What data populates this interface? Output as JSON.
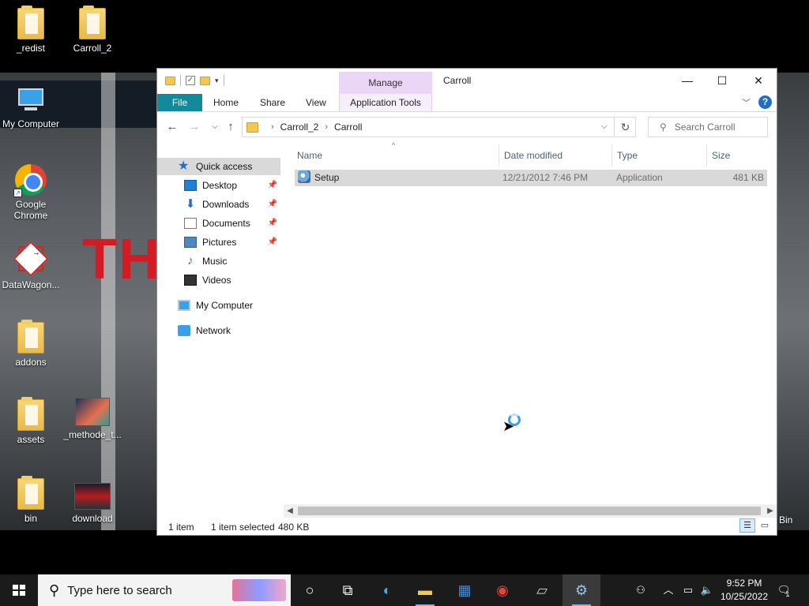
{
  "desktop": {
    "icons": [
      {
        "label": "_redist",
        "icon": "folder-icon"
      },
      {
        "label": "Carroll_2",
        "icon": "folder-icon"
      },
      {
        "label": "My Computer",
        "icon": "computer-icon"
      },
      {
        "label": "Google Chrome",
        "icon": "chrome-icon"
      },
      {
        "label": "DataWagon...",
        "icon": "datawagon-icon"
      },
      {
        "label": "addons",
        "icon": "folder-icon"
      },
      {
        "label": "assets",
        "icon": "folder-icon"
      },
      {
        "label": "_methode_t...",
        "icon": "image-icon"
      },
      {
        "label": "bin",
        "icon": "folder-icon"
      },
      {
        "label": "download",
        "icon": "image-icon"
      }
    ],
    "recycle_bin_partial": "Bin",
    "wallpaper_text": "TH"
  },
  "explorer": {
    "title": "Carroll",
    "context_tab_group": "Manage",
    "ribbon_tabs": [
      "File",
      "Home",
      "Share",
      "View",
      "Application Tools"
    ],
    "breadcrumb": [
      "Carroll_2",
      "Carroll"
    ],
    "search_placeholder": "Search Carroll",
    "nav_pane": {
      "quick_access": "Quick access",
      "items": [
        {
          "label": "Desktop",
          "pinned": true
        },
        {
          "label": "Downloads",
          "pinned": true
        },
        {
          "label": "Documents",
          "pinned": true
        },
        {
          "label": "Pictures",
          "pinned": true
        },
        {
          "label": "Music",
          "pinned": false
        },
        {
          "label": "Videos",
          "pinned": false
        }
      ],
      "my_computer": "My Computer",
      "network": "Network"
    },
    "columns": [
      "Name",
      "Date modified",
      "Type",
      "Size"
    ],
    "files": [
      {
        "name": "Setup",
        "date_modified": "12/21/2012 7:46 PM",
        "type": "Application",
        "size": "481 KB"
      }
    ],
    "status": {
      "item_count": "1 item",
      "selection": "1 item selected",
      "selection_size": "480 KB"
    }
  },
  "taskbar": {
    "search_placeholder": "Type here to search",
    "time": "9:52 PM",
    "date": "10/25/2022",
    "notification_count": "1"
  },
  "colors": {
    "file_tab": "#128a9c",
    "context_tab": "#ecd6f7",
    "selection_row": "#d9d9d9",
    "taskbar": "#1b1b1b"
  }
}
